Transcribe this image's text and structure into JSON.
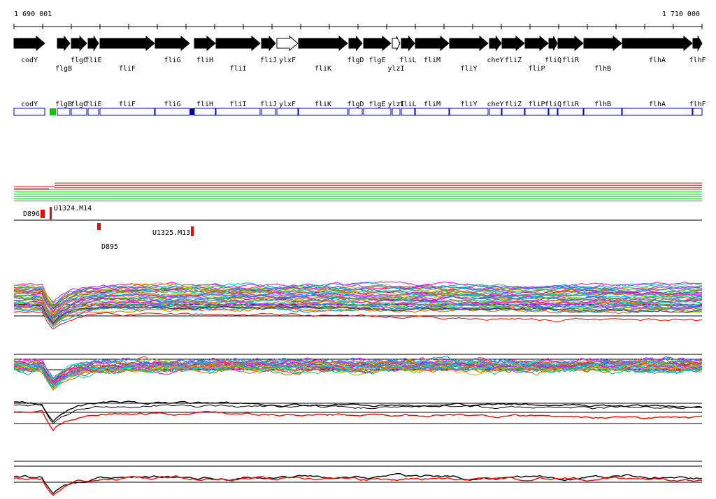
{
  "ruler": {
    "start_label": "1 690 001",
    "end_label": "1 710 000"
  },
  "genes": [
    {
      "name": "codY",
      "dir": "r",
      "row": 0
    },
    {
      "name": "flgB",
      "dir": "r",
      "row": 1
    },
    {
      "name": "flgC",
      "dir": "r",
      "row": 0
    },
    {
      "name": "fliE",
      "dir": "r",
      "row": 0
    },
    {
      "name": "fliF",
      "dir": "r",
      "row": 1
    },
    {
      "name": "fliG",
      "dir": "r",
      "row": 0
    },
    {
      "name": "fliH",
      "dir": "r",
      "row": 0
    },
    {
      "name": "fliI",
      "dir": "r",
      "row": 1
    },
    {
      "name": "fliJ",
      "dir": "r",
      "row": 0
    },
    {
      "name": "ylxF",
      "dir": "r",
      "row": 0,
      "hollow": true
    },
    {
      "name": "fliK",
      "dir": "r",
      "row": 1
    },
    {
      "name": "flgD",
      "dir": "r",
      "row": 0
    },
    {
      "name": "flgE",
      "dir": "r",
      "row": 0
    },
    {
      "name": "ylzI",
      "dir": "r",
      "row": 1,
      "hollow": true
    },
    {
      "name": "fliL",
      "dir": "r",
      "row": 0
    },
    {
      "name": "fliM",
      "dir": "r",
      "row": 0
    },
    {
      "name": "fliY",
      "dir": "r",
      "row": 1
    },
    {
      "name": "cheY",
      "dir": "r",
      "row": 0
    },
    {
      "name": "fliZ",
      "dir": "r",
      "row": 0
    },
    {
      "name": "fliP",
      "dir": "r",
      "row": 1
    },
    {
      "name": "fliQ",
      "dir": "r",
      "row": 0
    },
    {
      "name": "fliR",
      "dir": "r",
      "row": 0
    },
    {
      "name": "flhB",
      "dir": "r",
      "row": 1
    },
    {
      "name": "flhA",
      "dir": "r",
      "row": 0
    },
    {
      "name": "flhF",
      "dir": "r",
      "row": 0
    }
  ],
  "box_labels": [
    "codY",
    "flgB",
    "flgC",
    "fliE",
    "fliF",
    "fliG",
    "fliH",
    "fliI",
    "fliJ",
    "ylxF",
    "fliK",
    "flgD",
    "flgE",
    "ylzI",
    "fliL",
    "fliM",
    "fliY",
    "cheY",
    "fliZ",
    "fliP",
    "fliQ",
    "fliR",
    "flhB",
    "flhA",
    "flhF"
  ],
  "features": {
    "labels": [
      "D896",
      "U1324.M14",
      "D895",
      "U1325.M13"
    ]
  },
  "colors": {
    "gene": "#000000",
    "box_border": "#0000cc",
    "box_mark_green": "#00cc00",
    "box_mark_blue": "#000099",
    "red": "#ff0000",
    "green": "#00cc00"
  }
}
